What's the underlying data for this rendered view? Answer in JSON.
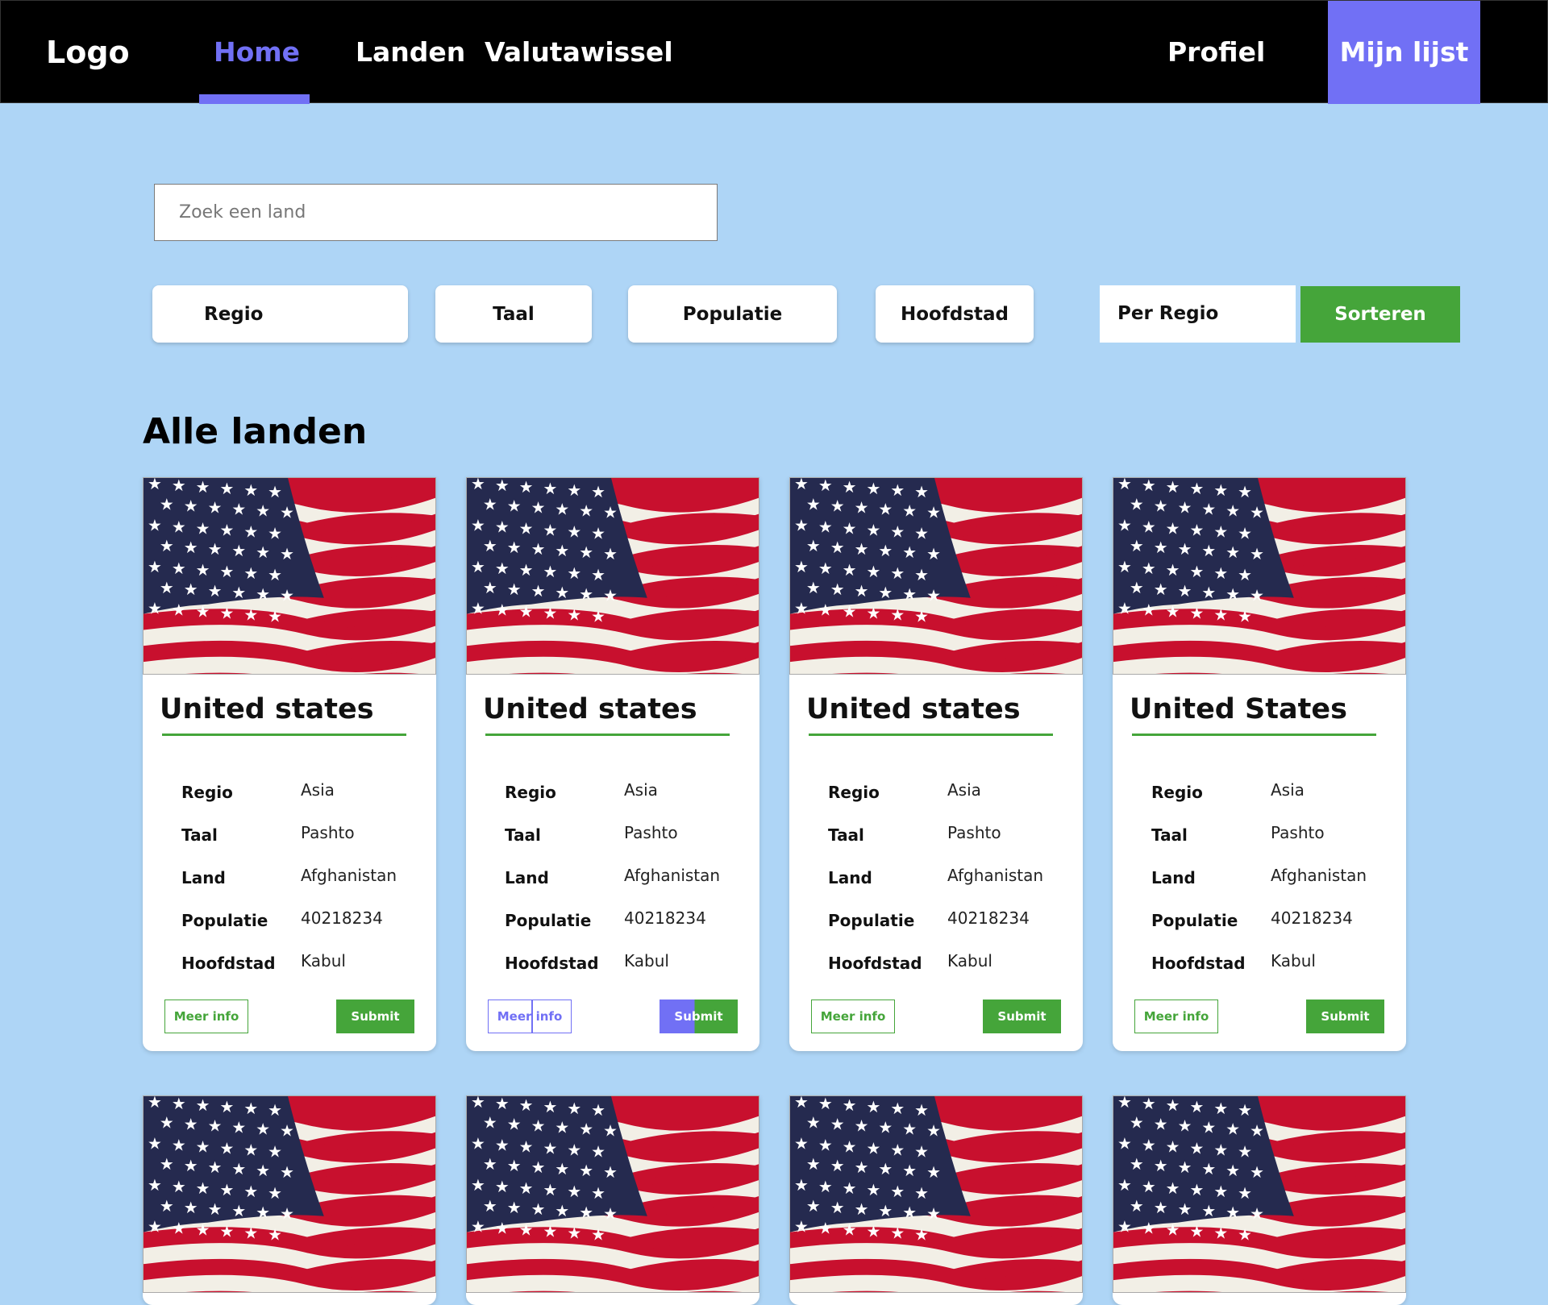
{
  "nav": {
    "logo": "Logo",
    "home": "Home",
    "landen": "Landen",
    "valutawissel": "Valutawissel",
    "profiel": "Profiel",
    "mijn_lijst": "Mijn lijst",
    "accent_color": "#7170f5"
  },
  "search": {
    "placeholder": "Zoek een land"
  },
  "filters": {
    "regio": "Regio",
    "taal": "Taal",
    "populatie": "Populatie",
    "hoofdstad": "Hoofdstad",
    "sort_option": "Per Regio",
    "sort_button": "Sorteren"
  },
  "section": {
    "title": "Alle landen"
  },
  "card_labels": {
    "regio": "Regio",
    "taal": "Taal",
    "land": "Land",
    "populatie": "Populatie",
    "hoofdstad": "Hoofdstad",
    "meer_info": "Meer info",
    "submit": "Submit"
  },
  "cards": [
    {
      "title": "United states",
      "regio": "Asia",
      "taal": "Pashto",
      "land": "Afghanistan",
      "populatie": "40218234",
      "hoofdstad": "Kabul"
    },
    {
      "title": "United states",
      "regio": "Asia",
      "taal": "Pashto",
      "land": "Afghanistan",
      "populatie": "40218234",
      "hoofdstad": "Kabul"
    },
    {
      "title": "United states",
      "regio": "Asia",
      "taal": "Pashto",
      "land": "Afghanistan",
      "populatie": "40218234",
      "hoofdstad": "Kabul"
    },
    {
      "title": "United States",
      "regio": "Asia",
      "taal": "Pashto",
      "land": "Afghanistan",
      "populatie": "40218234",
      "hoofdstad": "Kabul"
    }
  ],
  "colors": {
    "background": "#aed5f6",
    "green": "#45a53a",
    "purple": "#7170f5"
  }
}
